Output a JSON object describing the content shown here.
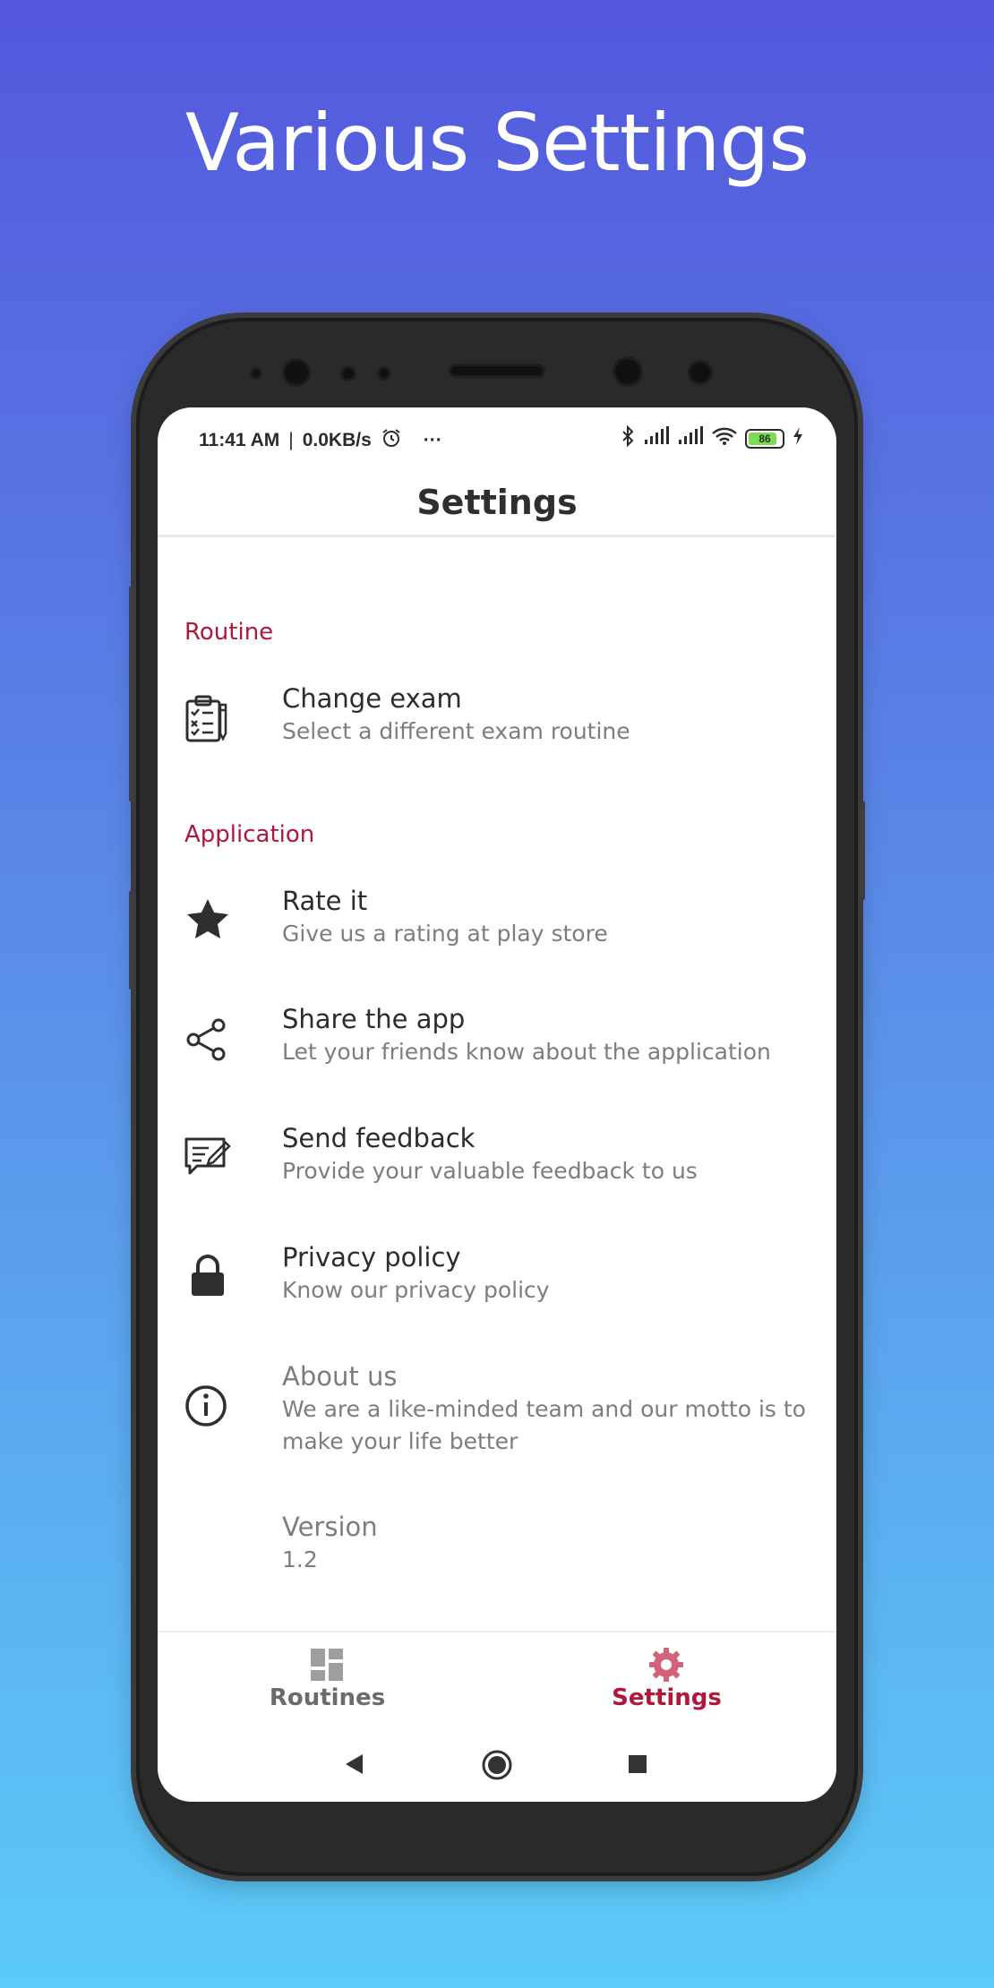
{
  "headline": "Various Settings",
  "status_bar": {
    "time": "11:41 AM",
    "separator": "|",
    "speed": "0.0KB/s",
    "more": "···",
    "battery_level": "86"
  },
  "app_bar": {
    "title": "Settings"
  },
  "sections": [
    {
      "header": "Routine",
      "items": [
        {
          "title": "Change exam",
          "subtitle": "Select a different exam routine"
        }
      ]
    },
    {
      "header": "Application",
      "items": [
        {
          "title": "Rate it",
          "subtitle": "Give us a rating at play store"
        },
        {
          "title": "Share the app",
          "subtitle": "Let your friends know about the application"
        },
        {
          "title": "Send feedback",
          "subtitle": "Provide your valuable feedback to us"
        },
        {
          "title": "Privacy policy",
          "subtitle": "Know our privacy policy"
        },
        {
          "title": "About us",
          "subtitle": "We are a like-minded team and our motto is to make your life better"
        },
        {
          "title": "Version",
          "subtitle": "1.2"
        }
      ]
    }
  ],
  "bottom_nav": {
    "items": [
      {
        "label": "Routines",
        "icon": "dashboard-icon",
        "active": false
      },
      {
        "label": "Settings",
        "icon": "gear-icon",
        "active": true
      }
    ]
  },
  "colors": {
    "accent": "#B0183B",
    "nav_inactive": "#6b6b6b",
    "icon_dark": "#2f2f2f"
  }
}
